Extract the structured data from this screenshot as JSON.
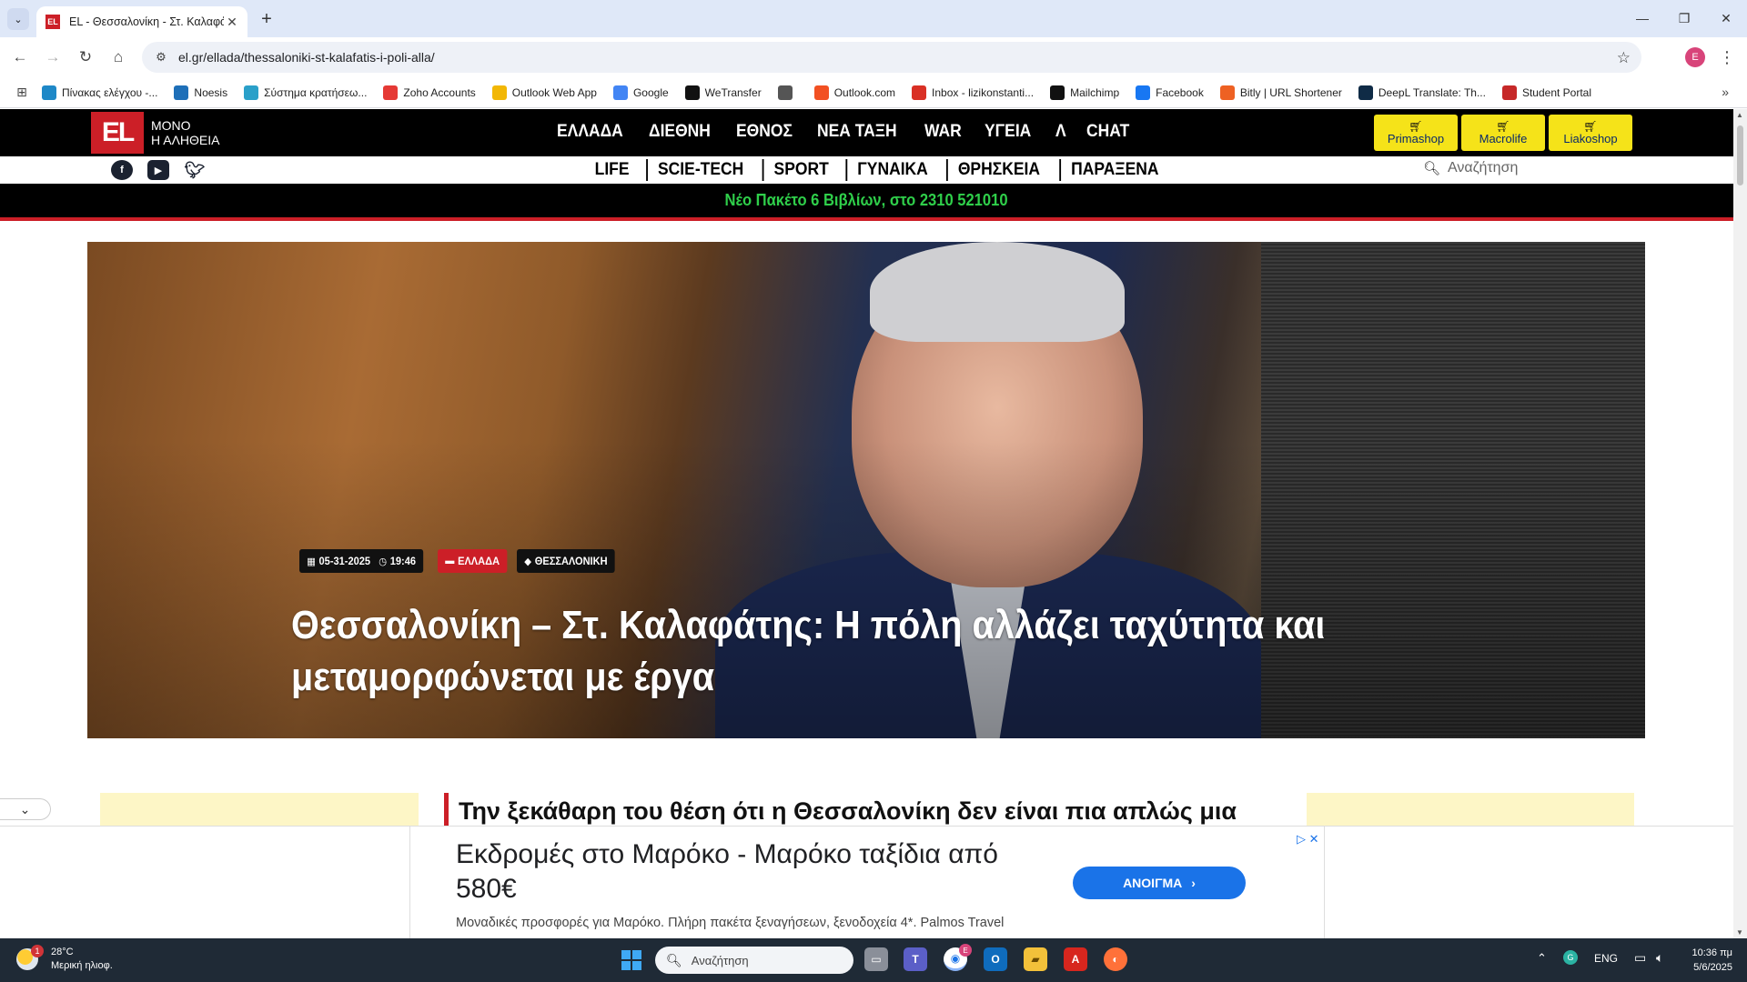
{
  "browser": {
    "tab_title": "EL - Θεσσαλονίκη - Στ. Καλαφάτης",
    "tab_favicon": "EL",
    "url": "el.gr/ellada/thessaloniki-st-kalafatis-i-poli-alla/",
    "profile_initial": "E",
    "bookmarks": [
      {
        "label": "Πίνακας ελέγχου -...",
        "icon": "dashboard-icon",
        "color": "#1e88c7"
      },
      {
        "label": "Noesis",
        "icon": "noesis-icon",
        "color": "#1e6fb8"
      },
      {
        "label": "Σύστημα κρατήσεω...",
        "icon": "booking-icon",
        "color": "#2aa0c9"
      },
      {
        "label": "Zoho Accounts",
        "icon": "zoho-icon",
        "color": "#e53935"
      },
      {
        "label": "Outlook Web App",
        "icon": "outlook-icon",
        "color": "#f2b705"
      },
      {
        "label": "Google",
        "icon": "google-icon",
        "color": "#4285f4"
      },
      {
        "label": "WeTransfer",
        "icon": "wetransfer-icon",
        "color": "#111111"
      },
      {
        "label": "",
        "icon": "globe-icon",
        "color": "#555555"
      },
      {
        "label": "Outlook.com",
        "icon": "microsoft-icon",
        "color": "#f25022"
      },
      {
        "label": "Inbox - lizikonstanti...",
        "icon": "gmail-icon",
        "color": "#d93025"
      },
      {
        "label": "Mailchimp",
        "icon": "mailchimp-icon",
        "color": "#111111"
      },
      {
        "label": "Facebook",
        "icon": "facebook-icon",
        "color": "#1877f2"
      },
      {
        "label": "Bitly | URL Shortener",
        "icon": "bitly-icon",
        "color": "#ee6123"
      },
      {
        "label": "DeepL Translate: Th...",
        "icon": "deepl-icon",
        "color": "#0f2b46"
      },
      {
        "label": "Student Portal",
        "icon": "portal-icon",
        "color": "#c62828"
      }
    ]
  },
  "site": {
    "logo_mark": "EL",
    "logo_tag_line1": "ΜΟΝΟ",
    "logo_tag_line2": "Η ΑΛΗΘΕΙΑ",
    "main_nav": [
      "ΕΛΛΑΔΑ",
      "ΔΙΕΘΝΗ",
      "ΕΘΝΟΣ",
      "ΝΕΑ ΤΑΞΗ",
      "WAR",
      "ΥΓΕΙΑ",
      "Λ",
      "CHAT"
    ],
    "shops": [
      "Primashop",
      "Macrolife",
      "Liakoshop"
    ],
    "sub_nav": [
      "LIFE",
      "SCIE-TECH",
      "SPORT",
      "ΓΥΝΑΙΚΑ",
      "ΘΡΗΣΚΕΙΑ",
      "ΠΑΡΑΞΕΝΑ"
    ],
    "search_placeholder": "Αναζήτηση",
    "promo": "Νέο Πακέτο 6 Βιβλίων, στο 2310 521010",
    "brand_red": "#cc1f27",
    "shop_yellow": "#f5e319",
    "promo_green": "#2fcf4a"
  },
  "article": {
    "date": "05-31-2025",
    "time": "19:46",
    "category": "ΕΛΛΑΔΑ",
    "topic": "ΘΕΣΣΑΛΟΝΙΚΗ",
    "headline": "Θεσσαλονίκη – Στ. Καλαφάτης: Η πόλη αλλάζει ταχύτητα και μεταμορφώνεται με έργα",
    "lead_partial": "Την ξεκάθαρη του θέση ότι η Θεσσαλονίκη δεν είναι πια απλώς μια"
  },
  "ad": {
    "title": "Εκδρομές στο Μαρόκο - Μαρόκο ταξίδια από 580€",
    "description": "Μοναδικές προσφορές για Μαρόκο. Πλήρη πακέτα ξεναγήσεων, ξενοδοχεία 4*. Palmos Travel",
    "button": "ΑΝΟΙΓΜΑ",
    "choices": "▷ ✕"
  },
  "taskbar": {
    "temperature": "28°C",
    "weather": "Μερική ηλιοφ.",
    "weather_badge": "1",
    "search_placeholder": "Αναζήτηση",
    "chrome_badge": "E",
    "language": "ENG",
    "time": "10:36 πμ",
    "date": "5/6/2025"
  }
}
